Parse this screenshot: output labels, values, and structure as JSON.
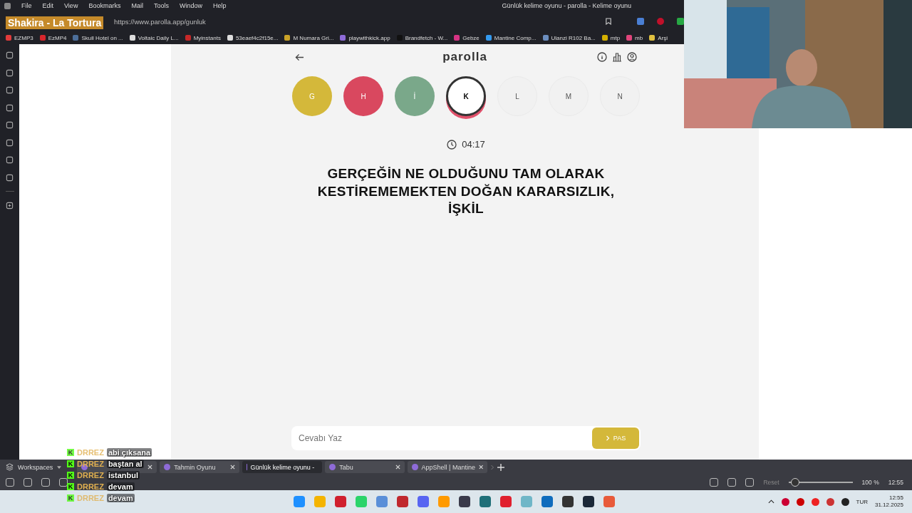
{
  "now_playing": "Shakira - La Tortura",
  "menu": [
    "File",
    "Edit",
    "View",
    "Bookmarks",
    "Mail",
    "Tools",
    "Window",
    "Help"
  ],
  "window": {
    "title": "Günlük kelime oyunu - parolla - Kelime oyunu"
  },
  "address": {
    "url": "https://www.parolla.app/gunluk"
  },
  "bookmarks": [
    {
      "label": "EZMP3",
      "color": "#e23b3b"
    },
    {
      "label": "EzMP4",
      "color": "#d8262c"
    },
    {
      "label": "Skull Hotel on ...",
      "color": "#4c6e9a"
    },
    {
      "label": "Voltaic Daily L...",
      "color": "#dddddd"
    },
    {
      "label": "Myinstants",
      "color": "#c62828"
    },
    {
      "label": "53eaef4c2f15e...",
      "color": "#dddddd"
    },
    {
      "label": "M Numara Gri...",
      "color": "#c9a227"
    },
    {
      "label": "playwithkick.app",
      "color": "#8e6bd8"
    },
    {
      "label": "Brandfetch - W...",
      "color": "#111111"
    },
    {
      "label": "Gebze",
      "color": "#d63384"
    },
    {
      "label": "Mantine Comp...",
      "color": "#339af0"
    },
    {
      "label": "Ulanzi R102 Ba...",
      "color": "#6c8ebf"
    },
    {
      "label": "mtp",
      "color": "#d4b000"
    },
    {
      "label": "mb",
      "color": "#e0457b"
    },
    {
      "label": "Arşi",
      "color": "#e0c040"
    }
  ],
  "game": {
    "logo": "parolla",
    "letters": [
      {
        "letter": "G",
        "kind": "passed",
        "selected": false
      },
      {
        "letter": "H",
        "kind": "wrong",
        "selected": false
      },
      {
        "letter": "İ",
        "kind": "correct",
        "selected": false
      },
      {
        "letter": "K",
        "kind": "pending",
        "selected": true
      },
      {
        "letter": "L",
        "kind": "pending",
        "selected": false
      },
      {
        "letter": "M",
        "kind": "pending",
        "selected": false
      },
      {
        "letter": "N",
        "kind": "pending",
        "selected": false
      }
    ],
    "timer": "04:17",
    "question": "GERÇEĞİN NE OLDUĞUNU TAM OLARAK KESTİREMEMEKTEN DOĞAN KARARSIZLIK, İŞKİL",
    "answer": {
      "placeholder": "Cevabı Yaz"
    },
    "pass_button": "PAS"
  },
  "chat": [
    {
      "badge": "K",
      "user": "DRREZ",
      "text": "abi çıksana",
      "faded": true
    },
    {
      "badge": "K",
      "user": "DRREZ",
      "text": "baştan al",
      "faded": false
    },
    {
      "badge": "K",
      "user": "DRREZ",
      "text": "istanbul",
      "faded": false
    },
    {
      "badge": "K",
      "user": "DRREZ",
      "text": "devam",
      "faded": false
    },
    {
      "badge": "K",
      "user": "DRREZ",
      "text": "devam",
      "faded": true
    }
  ],
  "workspaces": "Workspaces",
  "tabs": [
    {
      "selected": false
    },
    {
      "label": "Tahmin Oyunu",
      "selected": false
    },
    {
      "label": "Günlük kelime oyunu -",
      "selected": true
    },
    {
      "label": "Tabu",
      "selected": false
    },
    {
      "label": "AppShell | Mantine",
      "selected": false
    }
  ],
  "status_bar": {
    "reset": "Reset",
    "zoom": {
      "level": 0.1
    },
    "zoom_text": "100 %",
    "time": "12:55"
  },
  "taskbar": {
    "apps": [
      {
        "color": "#1e90ff"
      },
      {
        "color": "#f4b400"
      },
      {
        "color": "#d0202e"
      },
      {
        "color": "#2bd46a"
      },
      {
        "color": "#5a8fd8"
      },
      {
        "color": "#c0282d"
      },
      {
        "color": "#5865f2"
      },
      {
        "color": "#ff9a00"
      },
      {
        "color": "#3a3a4a"
      },
      {
        "color": "#1f6f78"
      },
      {
        "color": "#e0202e"
      },
      {
        "color": "#6fb6c7"
      },
      {
        "color": "#0f6cbd"
      },
      {
        "color": "#333333"
      },
      {
        "color": "#1b2838"
      },
      {
        "color": "#e85a3a"
      }
    ],
    "language": "TUR",
    "time": "12:55",
    "date": "31.12.2025"
  }
}
